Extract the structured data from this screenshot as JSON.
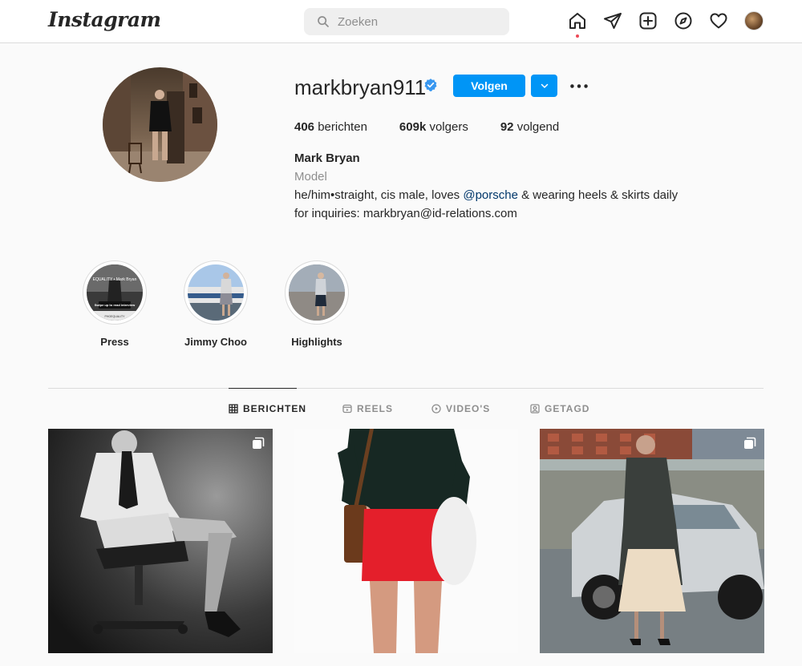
{
  "nav": {
    "logo": "Instagram",
    "search_placeholder": "Zoeken",
    "icons": [
      "home-icon",
      "direct-icon",
      "new-post-icon",
      "explore-icon",
      "activity-heart-icon",
      "profile-avatar"
    ]
  },
  "profile": {
    "username": "markbryan911",
    "verified": true,
    "follow_label": "Volgen",
    "stats": {
      "posts_count": "406",
      "posts_label": "berichten",
      "followers_count": "609k",
      "followers_label": "volgers",
      "following_count": "92",
      "following_label": "volgend"
    },
    "full_name": "Mark Bryan",
    "category": "Model",
    "bio_line1_pre": "he/him•straight, cis male, loves ",
    "bio_line1_mention": "@porsche",
    "bio_line1_post": " & wearing heels & skirts daily",
    "bio_line2": "for inquiries: markbryan@id-relations.com"
  },
  "highlights": [
    {
      "label": "Press"
    },
    {
      "label": "Jimmy Choo"
    },
    {
      "label": "Highlights"
    }
  ],
  "highlight_press_text": {
    "top": "EQUALITY • Mark Bryan",
    "mid": "Swipe up to read interview",
    "bottom": "PHOEQUALITY"
  },
  "tabs": [
    {
      "label": "BERICHTEN",
      "active": true
    },
    {
      "label": "REELS",
      "active": false
    },
    {
      "label": "VIDEO'S",
      "active": false
    },
    {
      "label": "GETAGD",
      "active": false
    }
  ],
  "colors": {
    "accent": "#0095f6",
    "mention": "#00376b",
    "notification_dot": "#ed4956"
  }
}
